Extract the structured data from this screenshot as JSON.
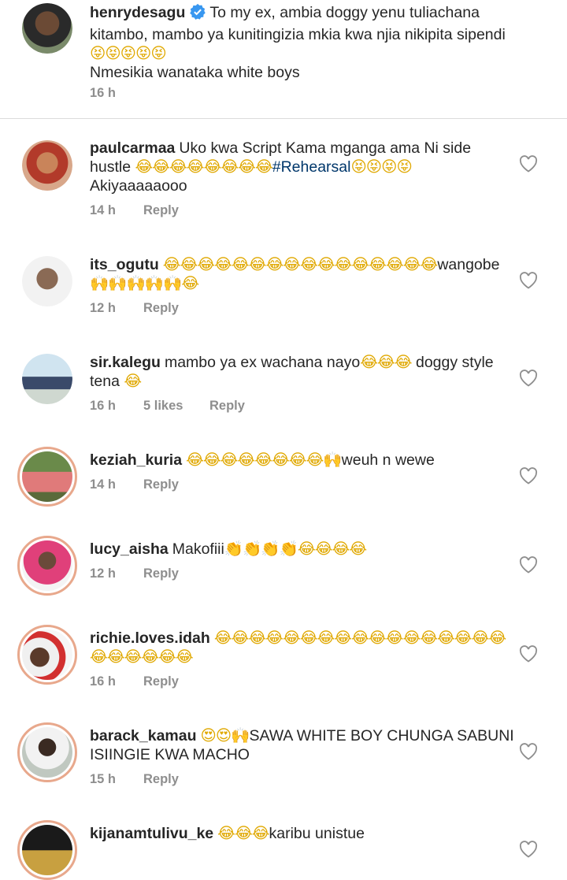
{
  "post": {
    "username": "henrydesagu",
    "caption_line1": "To my ex, ambia doggy yenu tuliachana kitambo, mambo ya kunitingizia mkia kwa njia nikipita sipendi",
    "caption_emoji": "😝😝😝😝😝",
    "caption_line2": "Nmesikia wanataka white boys",
    "time": "16 h"
  },
  "comments": [
    {
      "username": "paulcarmaa",
      "text_a": "Uko kwa Script Kama mganga ama Ni side hustle ",
      "emoji_a": "😂😂😂😂😂😂😂😂",
      "hashtag": "#Rehearsal",
      "emoji_b": "😝😝😝😝",
      "text_b": " Akiyaaaaaooo",
      "time": "14 h",
      "reply": "Reply"
    },
    {
      "username": "its_ogutu",
      "emoji_a": "😂😂😂😂😂😂😂😂😂😂😂😂😂😂😂😂",
      "text_a": "wangobe ",
      "emoji_b": "🙌🙌🙌🙌🙌😂",
      "time": "12 h",
      "reply": "Reply"
    },
    {
      "username": "sir.kalegu",
      "text_a": "mambo ya ex wachana nayo",
      "emoji_a": "😂😂😂",
      "text_b": " doggy style tena ",
      "emoji_b": "😂",
      "time": "16 h",
      "likes": "5 likes",
      "reply": "Reply"
    },
    {
      "username": "keziah_kuria",
      "emoji_a": "😂😂😂😂😂😂😂😂🙌",
      "text_a": "weuh n wewe",
      "time": "14 h",
      "reply": "Reply"
    },
    {
      "username": "lucy_aisha",
      "text_a": "Makofiii",
      "emoji_a": "👏👏👏👏😂😂😂😂",
      "time": "12 h",
      "reply": "Reply"
    },
    {
      "username": "richie.loves.idah",
      "emoji_a": "😂😂😂😂😂😂😂😂😂😂😂😂😂😂😂😂😂😂😂😂😂😂😂",
      "time": "16 h",
      "reply": "Reply"
    },
    {
      "username": "barack_kamau",
      "emoji_a": "😍😍🙌",
      "text_a": "SAWA WHITE BOY CHUNGA SABUNI ISIINGIE KWA MACHO",
      "time": "15 h",
      "reply": "Reply"
    },
    {
      "username": "kijanamtulivu_ke",
      "emoji_a": "😂😂😂",
      "text_a": "karibu unistue"
    }
  ],
  "colors": {
    "text": "#262626",
    "meta": "#8e8e8e",
    "hashtag": "#00376b",
    "verified": "#3897f0",
    "story_ring": "#e8a88c",
    "divider": "#dbdbdb"
  }
}
